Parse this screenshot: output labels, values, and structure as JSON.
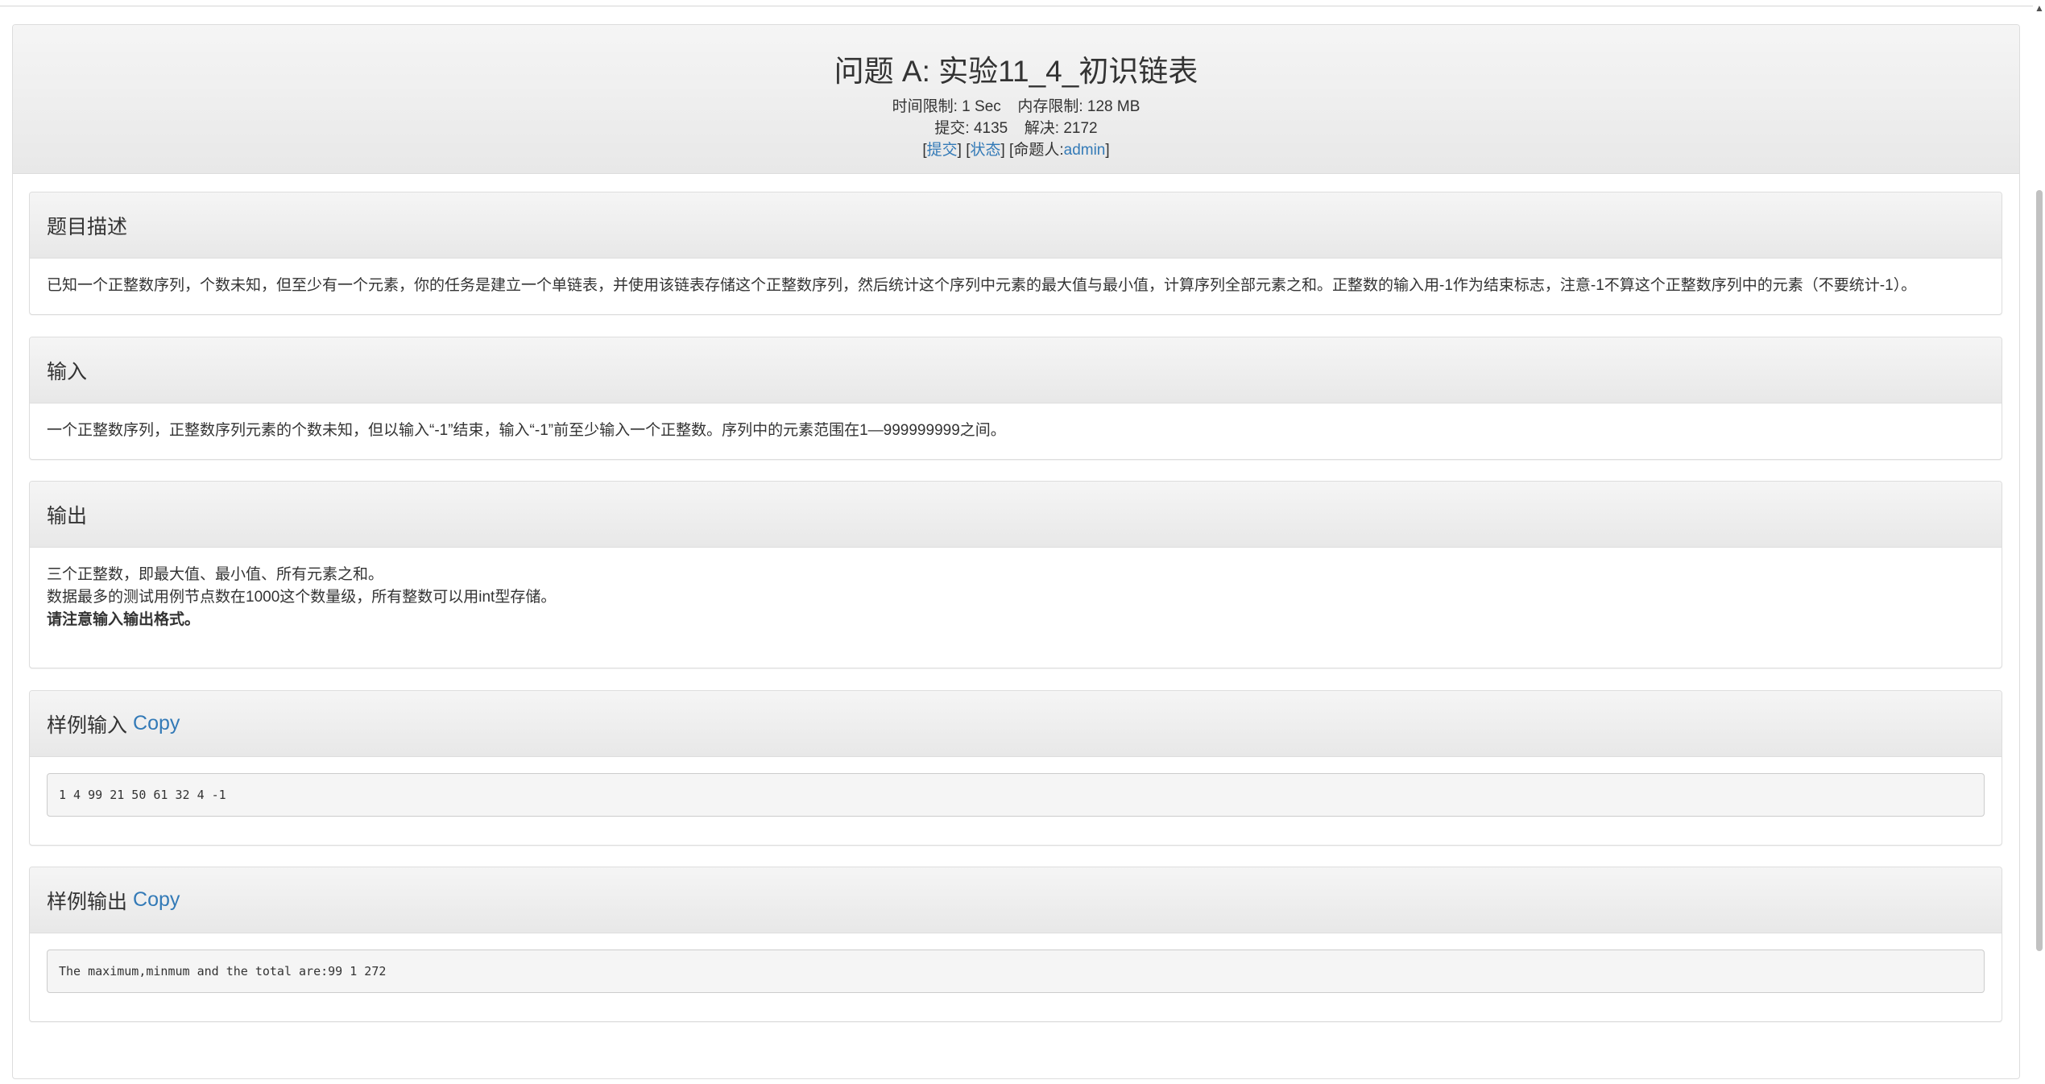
{
  "header": {
    "title": "问题 A: 实验11_4_初识链表",
    "time_limit_label": "时间限制:",
    "time_limit_value": "1 Sec",
    "memory_limit_label": "内存限制:",
    "memory_limit_value": "128 MB",
    "submit_count_label": "提交:",
    "submit_count_value": "4135",
    "solved_label": "解决:",
    "solved_value": "2172",
    "submit_link": "提交",
    "status_link": "状态",
    "setter_label": "命题人:",
    "setter_link": "admin"
  },
  "sections": {
    "description": {
      "heading": "题目描述",
      "text": "已知一个正整数序列，个数未知，但至少有一个元素，你的任务是建立一个单链表，并使用该链表存储这个正整数序列，然后统计这个序列中元素的最大值与最小值，计算序列全部元素之和。正整数的输入用-1作为结束标志，注意-1不算这个正整数序列中的元素（不要统计-1）。"
    },
    "input": {
      "heading": "输入",
      "text": "一个正整数序列，正整数序列元素的个数未知，但以输入“-1”结束，输入“-1”前至少输入一个正整数。序列中的元素范围在1—999999999之间。"
    },
    "output": {
      "heading": "输出",
      "line1": "三个正整数，即最大值、最小值、所有元素之和。",
      "line2": "数据最多的测试用例节点数在1000这个数量级，所有整数可以用int型存储。",
      "line3": "请注意输入输出格式。"
    },
    "sample_input": {
      "heading": "样例输入",
      "copy": "Copy",
      "content": "1 4 99 21 50 61 32 4 -1"
    },
    "sample_output": {
      "heading": "样例输出",
      "copy": "Copy",
      "content": "The maximum,minmum and the total are:99 1 272"
    }
  },
  "colors": {
    "link": "#337ab7",
    "text": "#333333",
    "panel_border": "#dddddd",
    "heading_bg": "#f5f5f5"
  }
}
